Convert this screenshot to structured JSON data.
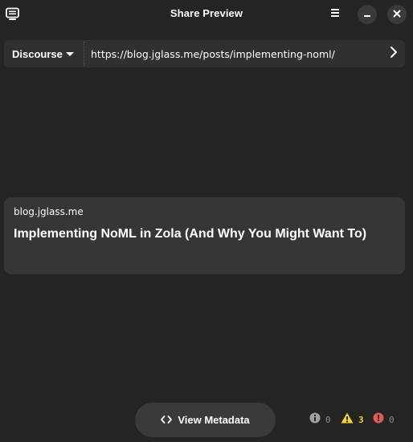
{
  "window": {
    "title": "Share Preview",
    "app_icon": "monitor-icon",
    "menu_icon": "hamburger-menu-icon",
    "minimize_icon": "minimize-icon",
    "close_icon": "close-icon"
  },
  "urlbar": {
    "service": "Discourse",
    "url": "https://blog.jglass.me/posts/implementing-noml/",
    "go_icon": "chevron-right-icon"
  },
  "card": {
    "site": "blog.jglass.me",
    "title": "Implementing NoML in Zola (And Why You Might Want To)"
  },
  "footer": {
    "view_metadata_label": "View Metadata",
    "view_metadata_icon": "code-icon",
    "info_count": "0",
    "warning_count": "3",
    "error_count": "0"
  },
  "colors": {
    "background": "#242424",
    "card": "#363636",
    "warning": "#f6d32d",
    "error": "#e05a5a",
    "info": "#a0a0a0"
  }
}
